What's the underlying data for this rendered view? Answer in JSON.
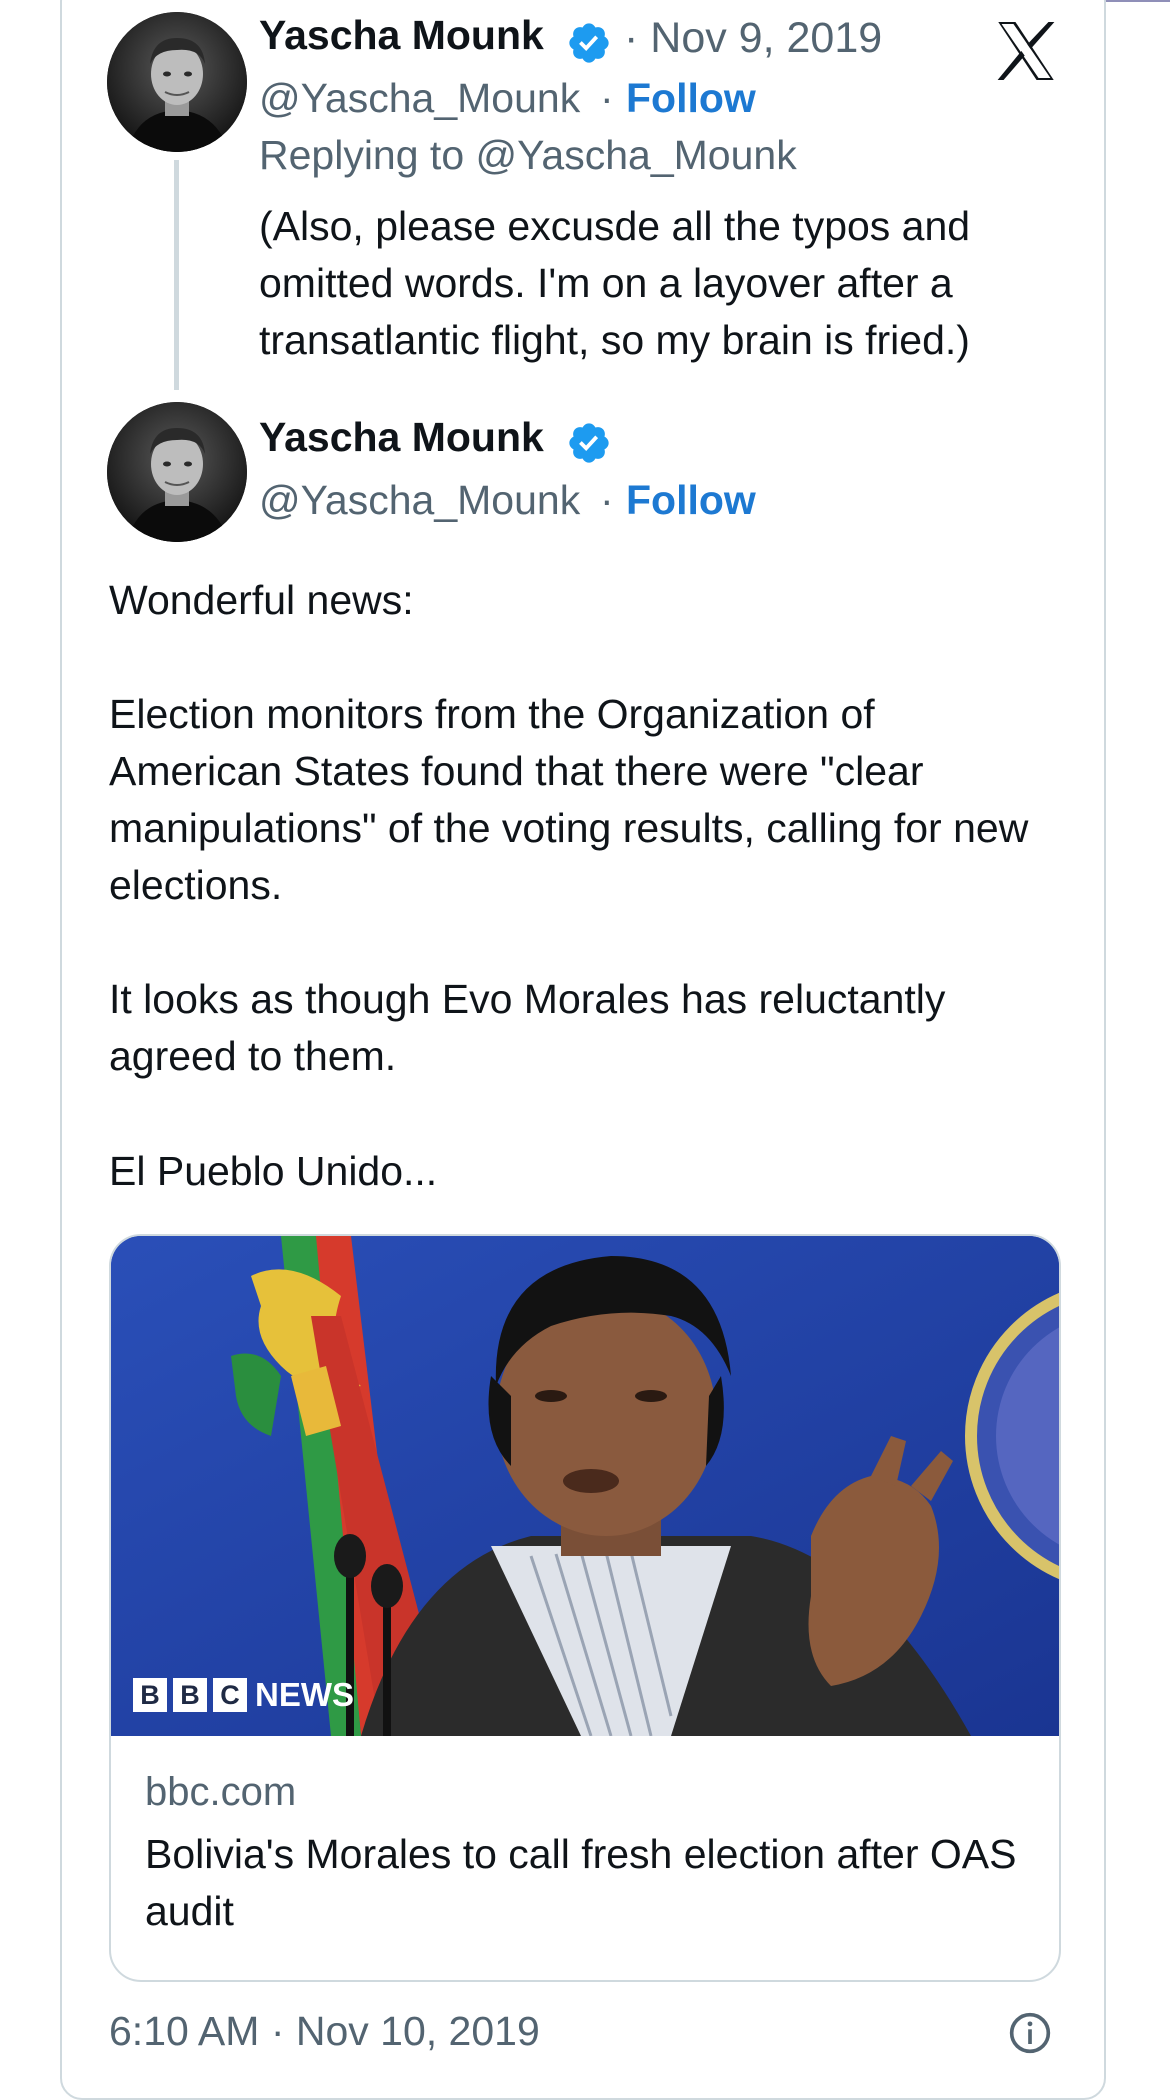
{
  "reply_tweet": {
    "author_name": "Yascha Mounk",
    "date": "· Nov 9, 2019",
    "handle": "@Yascha_Mounk",
    "follow_label": "Follow",
    "replying_to": "Replying to @Yascha_Mounk",
    "text": "(Also, please excusde all the typos and omitted words. I'm on a layover after a transatlantic flight, so my brain is fried.)"
  },
  "main_tweet": {
    "author_name": "Yascha Mounk",
    "handle": "@Yascha_Mounk",
    "follow_label": "Follow",
    "paragraphs": [
      "Wonderful news:",
      "Election monitors from the Organization of American States found that there were \"clear manipulations\" of the voting results, calling for new elections.",
      "It looks as though Evo Morales has reluctantly agreed to them.",
      "El Pueblo Unido..."
    ],
    "link_card": {
      "image_watermark_box_letters": [
        "B",
        "B",
        "C"
      ],
      "image_watermark_word": "NEWS",
      "domain": "bbc.com",
      "title": "Bolivia's Morales to call fresh election after OAS audit"
    },
    "timestamp": "6:10 AM · Nov 10, 2019"
  },
  "icons": {
    "platform_logo": "x-logo-icon",
    "verified": "verified-badge-icon",
    "info": "info-icon"
  },
  "colors": {
    "follow_blue": "#1d79d2",
    "verified_blue": "#1d9bf0",
    "secondary_text": "#536471",
    "border": "#cfd9de"
  }
}
